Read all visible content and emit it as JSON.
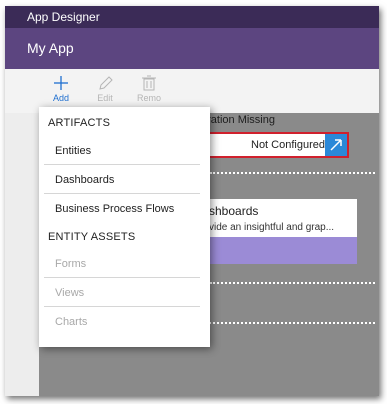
{
  "window": {
    "title": "App Designer"
  },
  "app": {
    "name": "My App"
  },
  "toolbar": {
    "add_label": "Add",
    "edit_label": "Edit",
    "remove_label": "Remo"
  },
  "config": {
    "title": "uration Missing",
    "prefix": "p",
    "value": "Not Configured"
  },
  "card": {
    "title": "shboards",
    "description": "vide an insightful and grap..."
  },
  "menu": {
    "artifacts_heading": "ARTIFACTS",
    "artifacts": [
      "Entities",
      "Dashboards",
      "Business Process Flows"
    ],
    "entity_assets_heading": "ENTITY ASSETS",
    "entity_assets": [
      "Forms",
      "Views",
      "Charts"
    ]
  },
  "colors": {
    "titlebar": "#3b2b57",
    "appbar": "#5c4580",
    "canvas": "#8a8a8a",
    "accent": "#2b88d8",
    "error_border": "#d0202d",
    "card_band": "#9b8bd6"
  }
}
